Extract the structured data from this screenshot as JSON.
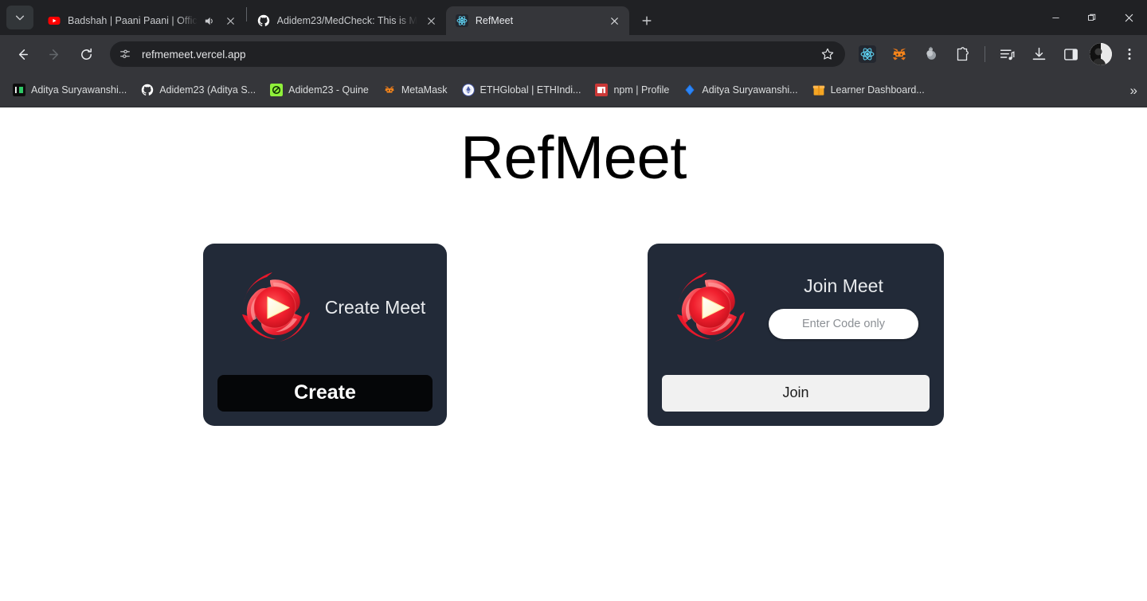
{
  "browser": {
    "tab_search_icon": "chevron-down-icon",
    "tabs": [
      {
        "title": "Badshah | Paani Paani | Offic",
        "favicon": "youtube-icon",
        "active": false,
        "audio": true
      },
      {
        "title": "Adidem23/MedCheck: This is M",
        "favicon": "github-icon",
        "active": false,
        "audio": false
      },
      {
        "title": "RefMeet",
        "favicon": "react-icon",
        "active": true,
        "audio": false
      }
    ],
    "new_tab_label": "+",
    "window_controls": {
      "minimize": "minimize-icon",
      "maximize": "restore-icon",
      "close": "close-icon"
    },
    "nav": {
      "back": "back-arrow-icon",
      "forward": "forward-arrow-icon",
      "reload": "reload-icon"
    },
    "omnibox": {
      "site_info_icon": "page-settings-icon",
      "url": "refmemeet.vercel.app",
      "bookmark_icon": "star-icon"
    },
    "extensions": [
      {
        "name": "react-devtools-icon"
      },
      {
        "name": "metamask-icon"
      },
      {
        "name": "grammar-extension-icon"
      },
      {
        "name": "extensions-puzzle-icon"
      }
    ],
    "toolbar_right": [
      {
        "name": "reading-list-icon"
      },
      {
        "name": "downloads-icon"
      },
      {
        "name": "side-panel-icon"
      },
      {
        "name": "profile-avatar"
      },
      {
        "name": "three-dot-menu-icon"
      }
    ],
    "bookmarks": [
      {
        "label": "Aditya Suryawanshi...",
        "icon": "hackerrank-icon"
      },
      {
        "label": "Adidem23 (Aditya S...",
        "icon": "github-icon"
      },
      {
        "label": "Adidem23 - Quine",
        "icon": "quine-icon"
      },
      {
        "label": "MetaMask",
        "icon": "metamask-icon"
      },
      {
        "label": "ETHGlobal | ETHIndi...",
        "icon": "ethglobal-icon"
      },
      {
        "label": "npm | Profile",
        "icon": "npm-icon"
      },
      {
        "label": "Aditya Suryawanshi...",
        "icon": "diamond-blue-icon"
      },
      {
        "label": "Learner Dashboard...",
        "icon": "box-orange-icon"
      }
    ],
    "bookmarks_overflow": "»"
  },
  "page": {
    "title": "RefMeet",
    "create_card": {
      "heading": "Create Meet",
      "logo_icon": "refmeet-logo-icon",
      "button_label": "Create"
    },
    "join_card": {
      "heading": "Join Meet",
      "logo_icon": "refmeet-logo-icon",
      "input_placeholder": "Enter Code only",
      "input_value": "",
      "button_label": "Join"
    }
  },
  "colors": {
    "page_bg": "#ffffff",
    "card_bg": "#222a38",
    "create_btn_bg": "#050608",
    "join_btn_bg": "#f1f1f1",
    "logo_red": "#e8182b",
    "chrome_toolbar": "#35363a",
    "chrome_tabstrip": "#202124"
  }
}
